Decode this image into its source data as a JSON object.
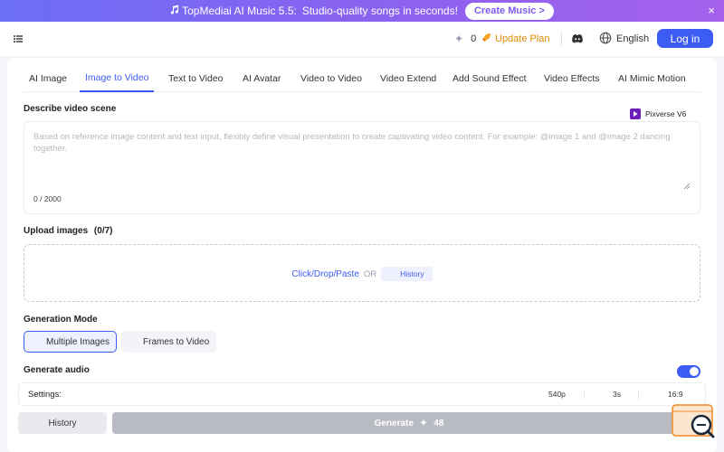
{
  "banner": {
    "icon": "music-note-icon",
    "title": "TopMediai AI Music 5.5:",
    "subtitle": "Studio-quality songs in seconds!",
    "cta": "Create Music >",
    "close": "×"
  },
  "header": {
    "credits": "0",
    "update_plan": "Update Plan",
    "language": "English",
    "login": "Log in"
  },
  "tabs": [
    {
      "label": "AI Image"
    },
    {
      "label": "Image to Video"
    },
    {
      "label": "Text to Video"
    },
    {
      "label": "AI Avatar"
    },
    {
      "label": "Video to Video"
    },
    {
      "label": "Video Extend"
    },
    {
      "label": "Add Sound Effect"
    },
    {
      "label": "Video Effects"
    },
    {
      "label": "AI Mimic Motion"
    }
  ],
  "active_tab": "Image to Video",
  "describe": {
    "label": "Describe video scene",
    "model": "Pixverse V6",
    "placeholder": "Based on reference image content and text input, flexibly define visual presentation to create captivating video content. For example: @image 1 and @image 2 dancing together.",
    "counter": "0 / 2000"
  },
  "upload": {
    "label": "Upload images",
    "count": "(0/7)",
    "link": "Click/Drop/Paste",
    "or": "OR",
    "history": "History"
  },
  "generation_mode": {
    "label": "Generation Mode",
    "options": [
      "Multiple Images",
      "Frames to Video"
    ],
    "selected": "Multiple Images"
  },
  "audio": {
    "label": "Generate audio",
    "enabled": true
  },
  "settings": {
    "label": "Settings:",
    "resolution": "540p",
    "duration": "3s",
    "ratio": "16:9"
  },
  "actions": {
    "history": "History",
    "generate": "Generate",
    "cost": "48"
  },
  "colors": {
    "accent": "#3d5cf4",
    "banner_start": "#6b6ef5",
    "banner_end": "#a561ee",
    "update": "#e08a00",
    "generate_disabled": "#b9bbc3"
  }
}
